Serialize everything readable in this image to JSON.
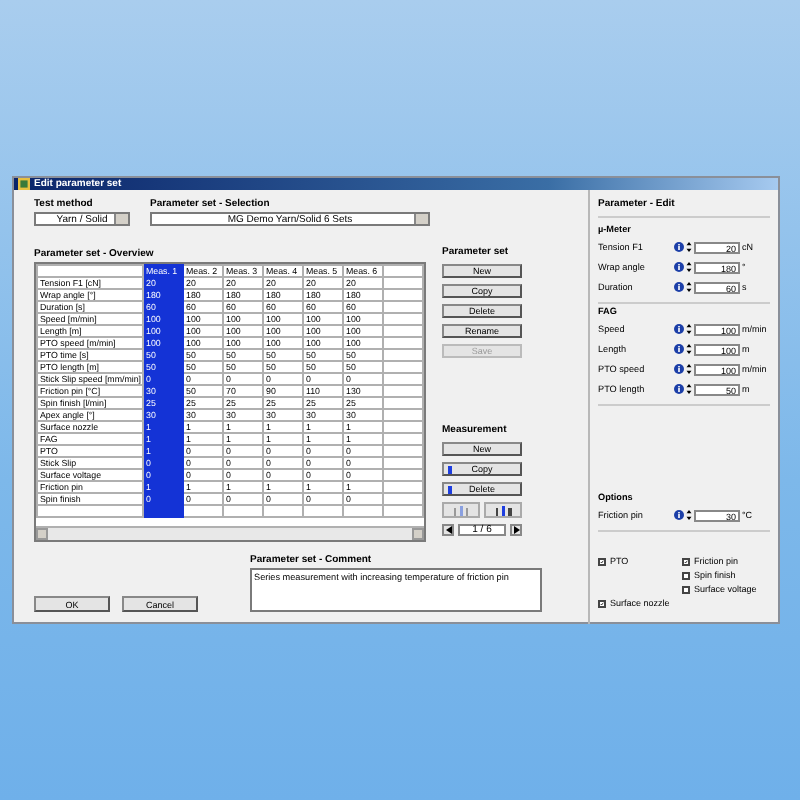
{
  "window": {
    "title": "Edit parameter set"
  },
  "test_method": {
    "label": "Test method",
    "value": "Yarn / Solid"
  },
  "parameter_selection": {
    "label": "Parameter set - Selection",
    "value": "MG Demo Yarn/Solid 6 Sets"
  },
  "overview": {
    "title": "Parameter set - Overview",
    "columns": [
      {
        "label": "Meas. 1",
        "selected": true
      },
      {
        "label": "Meas. 2",
        "selected": false
      },
      {
        "label": "Meas. 3",
        "selected": false
      },
      {
        "label": "Meas. 4",
        "selected": false
      },
      {
        "label": "Meas. 5",
        "selected": false
      },
      {
        "label": "Meas. 6",
        "selected": false
      }
    ],
    "rows": [
      {
        "label": "Tension F1 [cN]",
        "values": [
          "20",
          "20",
          "20",
          "20",
          "20",
          "20"
        ]
      },
      {
        "label": "Wrap angle [°]",
        "values": [
          "180",
          "180",
          "180",
          "180",
          "180",
          "180"
        ]
      },
      {
        "label": "Duration [s]",
        "values": [
          "60",
          "60",
          "60",
          "60",
          "60",
          "60"
        ]
      },
      {
        "label": "Speed [m/min]",
        "values": [
          "100",
          "100",
          "100",
          "100",
          "100",
          "100"
        ]
      },
      {
        "label": "Length [m]",
        "values": [
          "100",
          "100",
          "100",
          "100",
          "100",
          "100"
        ]
      },
      {
        "label": "PTO speed [m/min]",
        "values": [
          "100",
          "100",
          "100",
          "100",
          "100",
          "100"
        ]
      },
      {
        "label": "PTO time [s]",
        "values": [
          "50",
          "50",
          "50",
          "50",
          "50",
          "50"
        ]
      },
      {
        "label": "PTO length [m]",
        "values": [
          "50",
          "50",
          "50",
          "50",
          "50",
          "50"
        ]
      },
      {
        "label": "Stick Slip speed [mm/min]",
        "values": [
          "0",
          "0",
          "0",
          "0",
          "0",
          "0"
        ]
      },
      {
        "label": "Friction pin [°C]",
        "values": [
          "30",
          "50",
          "70",
          "90",
          "110",
          "130"
        ]
      },
      {
        "label": "Spin finish [l/min]",
        "values": [
          "25",
          "25",
          "25",
          "25",
          "25",
          "25"
        ]
      },
      {
        "label": "Apex angle [°]",
        "values": [
          "30",
          "30",
          "30",
          "30",
          "30",
          "30"
        ]
      },
      {
        "label": "Surface nozzle",
        "values": [
          "1",
          "1",
          "1",
          "1",
          "1",
          "1"
        ]
      },
      {
        "label": "FAG",
        "values": [
          "1",
          "1",
          "1",
          "1",
          "1",
          "1"
        ]
      },
      {
        "label": "PTO",
        "values": [
          "1",
          "0",
          "0",
          "0",
          "0",
          "0"
        ]
      },
      {
        "label": "Stick Slip",
        "values": [
          "0",
          "0",
          "0",
          "0",
          "0",
          "0"
        ]
      },
      {
        "label": "Surface voltage",
        "values": [
          "0",
          "0",
          "0",
          "0",
          "0",
          "0"
        ]
      },
      {
        "label": "Friction pin",
        "values": [
          "1",
          "1",
          "1",
          "1",
          "1",
          "1"
        ]
      },
      {
        "label": "Spin finish",
        "values": [
          "0",
          "0",
          "0",
          "0",
          "0",
          "0"
        ]
      }
    ]
  },
  "parameter_set": {
    "title": "Parameter set",
    "buttons": [
      {
        "label": "New",
        "disabled": false
      },
      {
        "label": "Copy",
        "disabled": false
      },
      {
        "label": "Delete",
        "disabled": false
      },
      {
        "label": "Rename",
        "disabled": false
      },
      {
        "label": "Save",
        "disabled": true
      }
    ]
  },
  "measurement": {
    "title": "Measurement",
    "buttons": [
      {
        "label": "New",
        "marked": false
      },
      {
        "label": "Copy",
        "marked": true
      },
      {
        "label": "Delete",
        "marked": true
      }
    ],
    "page": "1 / 6"
  },
  "comment": {
    "title": "Parameter set - Comment",
    "value": "Series measurement with increasing temperature of friction pin"
  },
  "buttons": [
    "OK",
    "Cancel"
  ],
  "edit": {
    "title": "Parameter - Edit",
    "groups": [
      {
        "title": "µ-Meter",
        "fields": [
          {
            "label": "Tension F1",
            "value": "20",
            "unit": "cN"
          },
          {
            "label": "Wrap angle",
            "value": "180",
            "unit": "°"
          },
          {
            "label": "Duration",
            "value": "60",
            "unit": "s"
          }
        ]
      },
      {
        "title": "FAG",
        "fields": [
          {
            "label": "Speed",
            "value": "100",
            "unit": "m/min"
          },
          {
            "label": "Length",
            "value": "100",
            "unit": "m"
          },
          {
            "label": "PTO speed",
            "value": "100",
            "unit": "m/min"
          },
          {
            "label": "PTO length",
            "value": "50",
            "unit": "m"
          }
        ]
      },
      {
        "title": "Options",
        "fields": [
          {
            "label": "Friction pin",
            "value": "30",
            "unit": "°C"
          }
        ]
      }
    ]
  },
  "checkboxes_left": [
    {
      "label": "PTO",
      "checked": true
    },
    {
      "label": "Surface nozzle",
      "checked": true
    }
  ],
  "checkboxes_right": [
    {
      "label": "Friction pin",
      "checked": true
    },
    {
      "label": "Spin finish",
      "checked": false
    },
    {
      "label": "Surface voltage",
      "checked": false
    }
  ]
}
